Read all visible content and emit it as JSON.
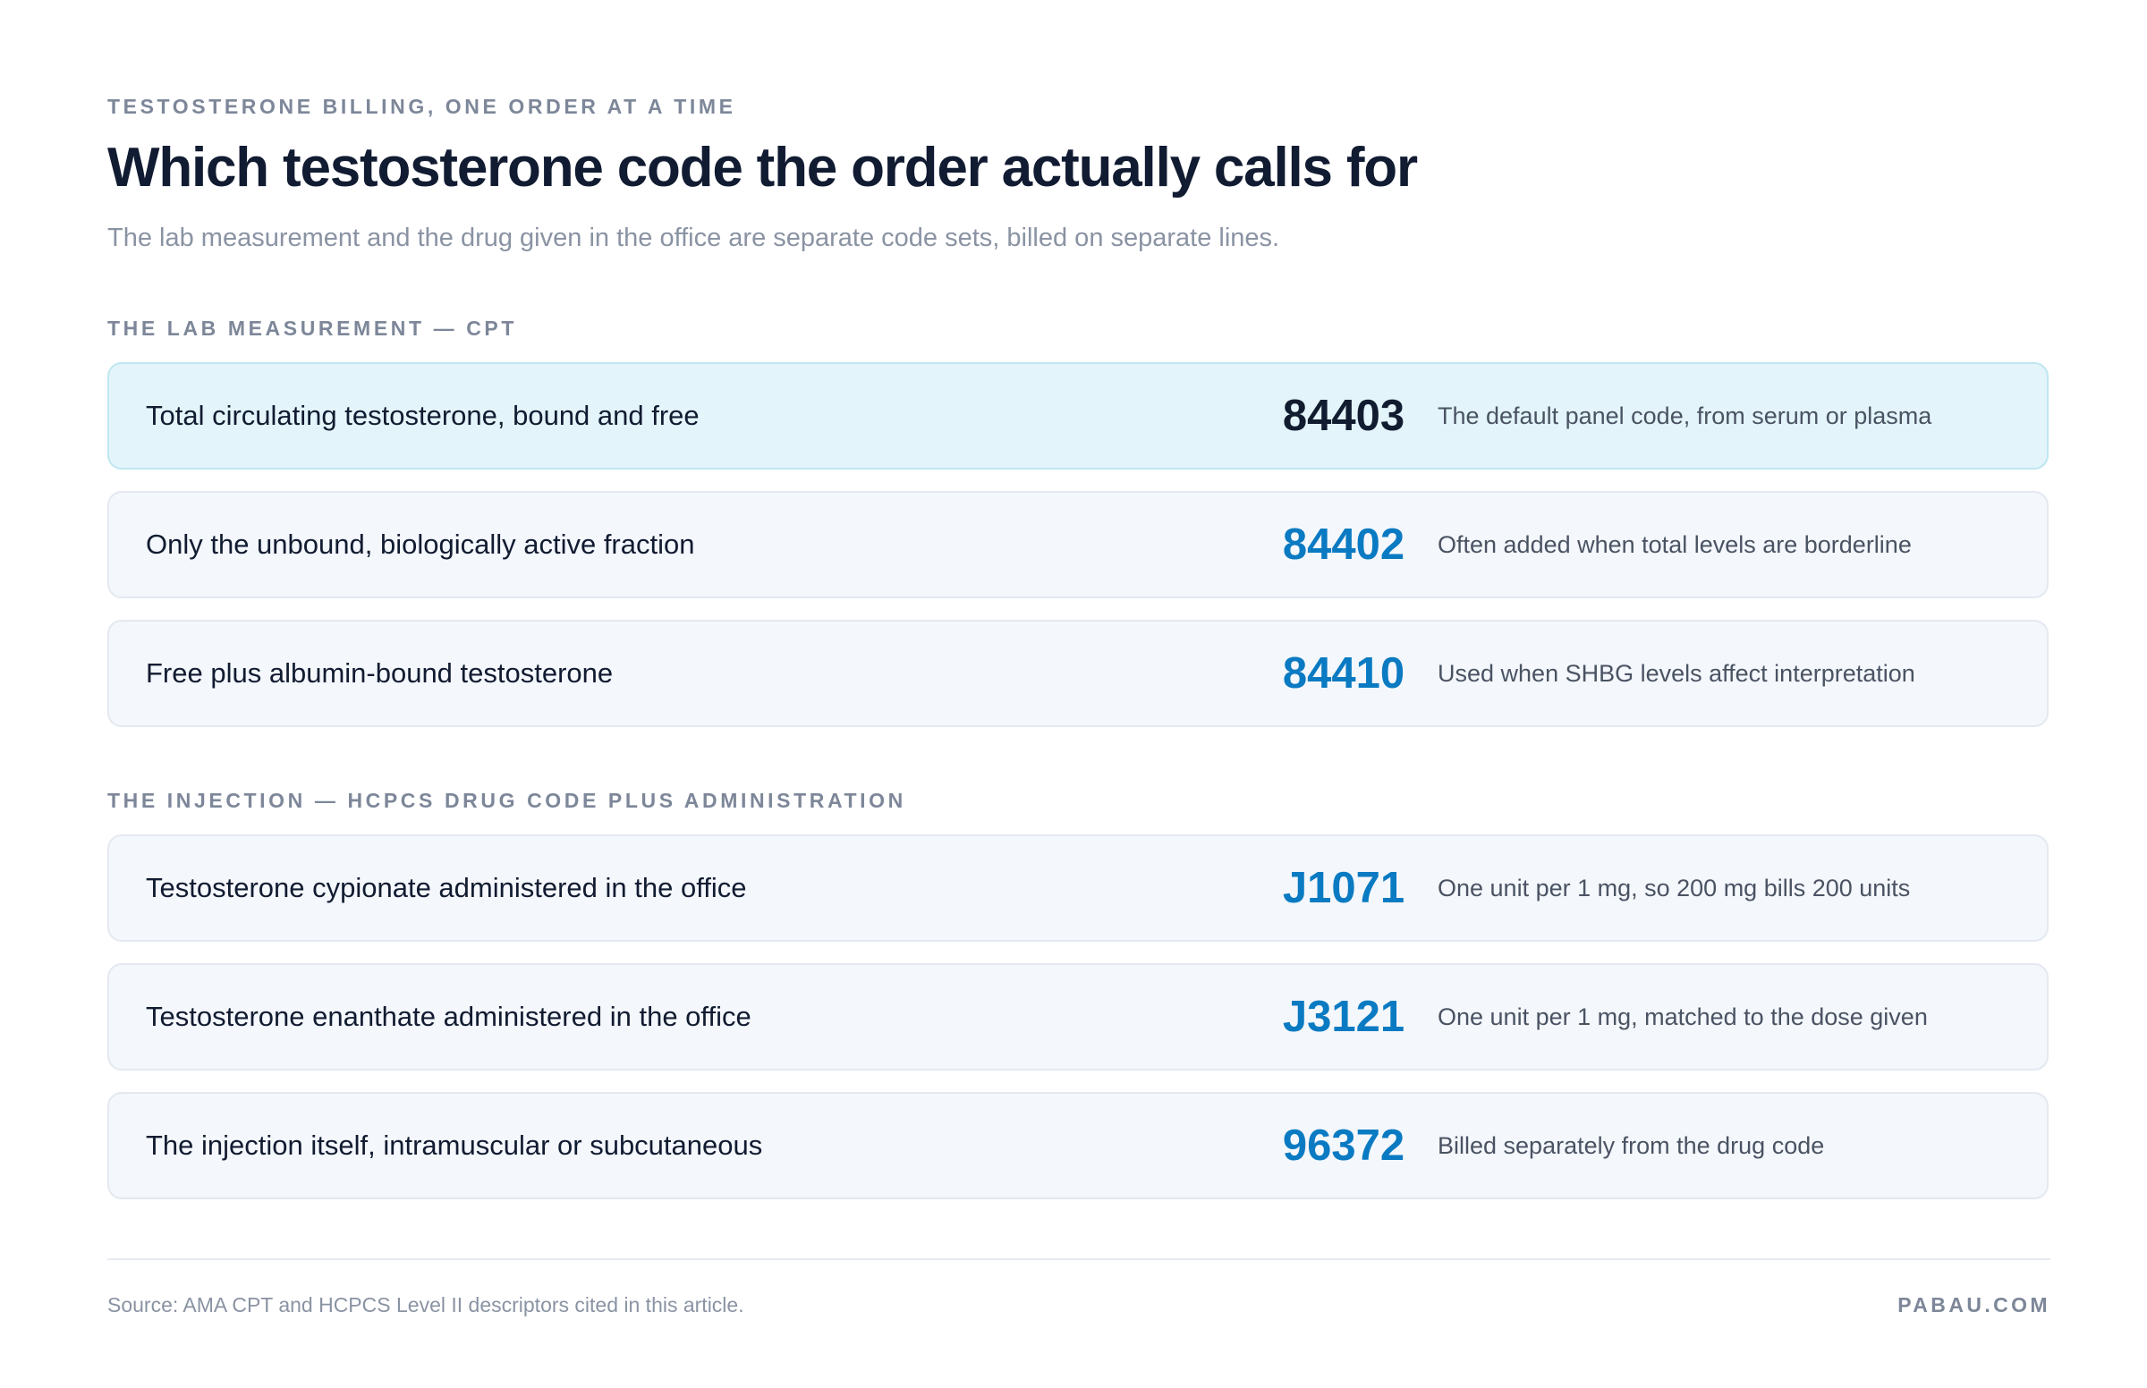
{
  "header": {
    "eyebrow": "TESTOSTERONE BILLING, ONE ORDER AT A TIME",
    "title": "Which testosterone code the order actually calls for",
    "subtitle": "The lab measurement and the drug given in the office are separate code sets, billed on separate lines."
  },
  "sections": [
    {
      "label": "THE LAB MEASUREMENT — CPT",
      "rows": [
        {
          "description": "Total circulating testosterone, bound and free",
          "code": "84403",
          "note": "The default panel code, from serum or plasma",
          "highlighted": true
        },
        {
          "description": "Only the unbound, biologically active fraction",
          "code": "84402",
          "note": "Often added when total levels are borderline",
          "highlighted": false
        },
        {
          "description": "Free plus albumin-bound testosterone",
          "code": "84410",
          "note": "Used when SHBG levels affect interpretation",
          "highlighted": false
        }
      ]
    },
    {
      "label": "THE INJECTION — HCPCS DRUG CODE PLUS ADMINISTRATION",
      "rows": [
        {
          "description": "Testosterone cypionate administered in the office",
          "code": "J1071",
          "note": "One unit per 1 mg, so 200 mg bills 200 units",
          "highlighted": false
        },
        {
          "description": "Testosterone enanthate administered in the office",
          "code": "J3121",
          "note": "One unit per 1 mg, matched to the dose given",
          "highlighted": false
        },
        {
          "description": "The injection itself, intramuscular or subcutaneous",
          "code": "96372",
          "note": "Billed separately from the drug code",
          "highlighted": false
        }
      ]
    }
  ],
  "footer": {
    "source": "Source: AMA CPT and HCPCS Level II descriptors cited in this article.",
    "brand": "PABAU.COM"
  },
  "colors": {
    "code_accent": "#0a7ac2",
    "highlight_background": "#e3f5fa",
    "row_background": "#f4f7fb",
    "title_text": "#111b31",
    "muted_text": "#7d8799"
  }
}
